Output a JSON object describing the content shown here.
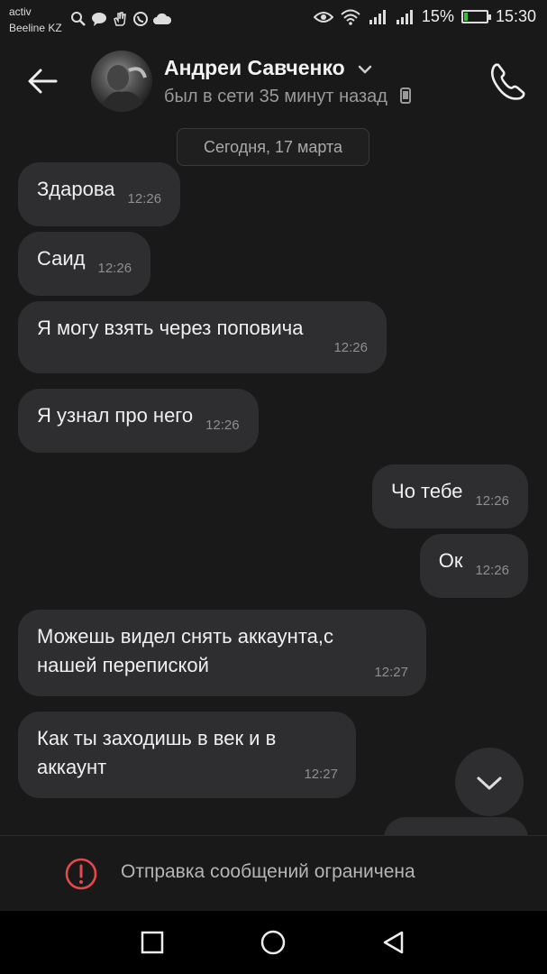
{
  "status_bar": {
    "carrier_line1": "activ",
    "carrier_line2": "Beeline KZ",
    "battery_percent": "15%",
    "battery_level": 0.15,
    "time": "15:30",
    "icons": [
      "search-icon",
      "chat-icon",
      "hand-icon",
      "whatsapp-icon",
      "cloud-icon",
      "eye-icon",
      "wifi-icon",
      "signal-icon",
      "signal-icon",
      "battery-icon"
    ]
  },
  "header": {
    "contact_name": "Андреи Савченко",
    "last_seen": "был в сети 35 минут назад"
  },
  "date_chip": "Сегодня, 17 марта",
  "messages": [
    {
      "text": "Здарова",
      "time": "12:26",
      "direction": "in"
    },
    {
      "text": "Саид",
      "time": "12:26",
      "direction": "in"
    },
    {
      "text": "Я могу взять через поповича",
      "time": "12:26",
      "direction": "in"
    },
    {
      "text": "Я узнал про него",
      "time": "12:26",
      "direction": "in"
    },
    {
      "text": "Чо тебе",
      "time": "12:26",
      "direction": "out"
    },
    {
      "text": "Ок",
      "time": "12:26",
      "direction": "out"
    },
    {
      "lines": [
        "Можешь видел снять аккаунта,с",
        "нашей перепиской"
      ],
      "time": "12:27",
      "direction": "in"
    },
    {
      "lines": [
        "Как ты заходишь в век и в",
        "аккаунт"
      ],
      "time": "12:27",
      "direction": "in"
    }
  ],
  "restriction_notice": "Отправка сообщений ограничена",
  "colors": {
    "background": "#19191a",
    "bubble": "#2e2e30",
    "warning": "#e5484d",
    "battery_fill": "#3bbf3b"
  }
}
